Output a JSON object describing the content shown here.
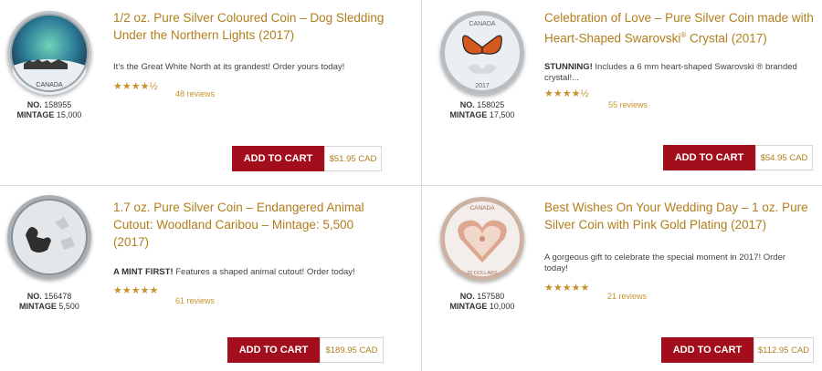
{
  "products": [
    {
      "title": "1/2 oz. Pure Silver Coloured Coin – Dog Sledding Under the Northern Lights (2017)",
      "desc_strong": "",
      "desc": "It’s the Great White North at its grandest! Order yours today!",
      "rating_stars": "★★★★½",
      "rating": 4.5,
      "reviews": "48 reviews",
      "no_label": "NO.",
      "no": "158955",
      "mintage_label": "MINTAGE",
      "mintage": "15,000",
      "cart_label": "ADD TO CART",
      "price": "$51.95 CAD",
      "coin_text": "CANADA"
    },
    {
      "title": "Celebration of Love – Pure Silver Coin made with Heart-Shaped Swarovski",
      "title_sup": "®",
      "title_end": " Crystal (2017)",
      "desc_strong": "STUNNING!",
      "desc": " Includes a 6 mm heart-shaped Swarovski ® branded crystal!...",
      "rating_stars": "★★★★½",
      "rating": 4.5,
      "reviews": "55 reviews",
      "no_label": "NO.",
      "no": "158025",
      "mintage_label": "MINTAGE",
      "mintage": "17,500",
      "cart_label": "ADD TO CART",
      "price": "$54.95 CAD",
      "coin_text": "CANADA",
      "coin_year": "2017"
    },
    {
      "title": "1.7 oz. Pure Silver Coin – Endangered Animal Cutout: Woodland Caribou – Mintage: 5,500 (2017)",
      "desc_strong": "A MINT FIRST!",
      "desc": " Features a shaped animal cutout! Order today!",
      "rating_stars": "★★★★★",
      "rating": 5,
      "reviews": "61 reviews",
      "no_label": "NO.",
      "no": "156478",
      "mintage_label": "MINTAGE",
      "mintage": "5,500",
      "cart_label": "ADD TO CART",
      "price": "$189.95 CAD"
    },
    {
      "title": "Best Wishes On Your Wedding Day – 1 oz. Pure Silver Coin with Pink Gold Plating (2017)",
      "desc_strong": "",
      "desc": "A gorgeous gift to celebrate the special moment in 2017! Order today!",
      "rating_stars": "★★★★★",
      "rating": 5,
      "reviews": "21 reviews",
      "no_label": "NO.",
      "no": "157580",
      "mintage_label": "MINTAGE",
      "mintage": "10,000",
      "cart_label": "ADD TO CART",
      "price": "$112.95 CAD",
      "coin_text": "CANADA",
      "coin_denom": "20 DOLLARS"
    }
  ],
  "colors": {
    "accent_gold": "#b07e1c",
    "cart_red": "#a30e1c",
    "divider": "#dcdcdc"
  }
}
